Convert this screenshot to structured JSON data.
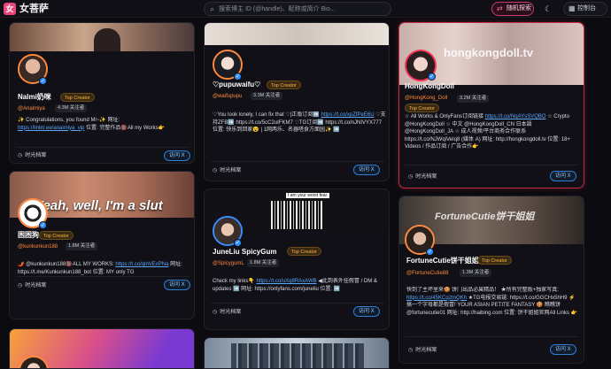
{
  "header": {
    "logo_glyph": "女",
    "app_name": "女菩萨",
    "search_placeholder": "搜索博主 ID (@handle)、昵称或简介 Bio...",
    "random_label": "随机探索",
    "console_label": "控制台"
  },
  "cards": [
    {
      "name": "Nalmi奶咪",
      "badge": "Top Creator",
      "handle": "@Analmiya",
      "followers": "4.3M 关注者",
      "bio_text": "✨ Congratulations, you found Mi~✨ 网址:",
      "bio_link": "https://linktr.ee/anaimiya_vip",
      "bio_tail": " 位置: 完整作品🔞All my Works👉",
      "archive": "时光档案",
      "visit": "访问 X"
    },
    {
      "name": "♡pupuwaifu♡",
      "badge": "Top Creator",
      "handle": "@waifupupu",
      "followers": "3.3M 关注者",
      "bio_text": "♡You look lonely, I can fix that ♡|正版订阅➡️",
      "bio_link": "https://t.co/xpZfPeE6U",
      "bio_tail": " ♡支持ZFB➡️ https://t.co/5cC2uIFKM7 ♡TG订阅➡️ https://t.co/nJNIVYX777 位置: 快乐到回家😵 | 1网两乐、名器嗒食方面园✨ ➡️",
      "archive": "时光档案",
      "visit": "访问 X"
    },
    {
      "name": "HongKongDoll",
      "badge": "Top Creator",
      "handle": "@HongKong_Doll",
      "followers": "3.2M 关注者",
      "banner_text": "hongkongdoll.tv",
      "bio_text": "☆ All Works & OnlyFans订阅链接 ",
      "bio_link": "https://t.co/NqAYsSVQBO",
      "bio_tail": " ☆ Crypto @HongKongDoll ☆ 中文 @HongKongDoll_CN 日本語 @HongKongDoll_JA ☆ 成人视频/平台商务合作联系 https://t.co/NJWqiVeIq8 (媒体 A) 网址: http://hongkongdoll.tv 位置: 18+ Videos / 作品订阅 / 广告合作👉",
      "archive": "时光档案",
      "visit": "访问 X"
    },
    {
      "name": "困困狗",
      "badge": "Top Creator",
      "handle": "@kunkunkun188",
      "followers": "1.8M 关注者",
      "banner_text": "Yeah, well, I'm a slut",
      "bio_text": "🌶️ @kunkunkun188🔞ALL MY WORKS: ",
      "bio_link": "https://t.co/qlnVExPNa",
      "bio_tail": " 网址: https://t.me/Kunkunkun188_bot 位置: MY only TG",
      "archive": "时光档案",
      "visit": "访问 X"
    },
    {
      "name": "JuneLiu SpicyGum",
      "badge": "Top Creator",
      "handle": "@SpicygumL",
      "followers": "1.8M 关注者",
      "banner_text": "I am your worst fear.",
      "bio_text": "Check my links👇 ",
      "bio_link": "https://t.co/uXq8RAxAWB",
      "bio_tail": " ◀此到表外挂假冒 / DM & updates ➡️ 网址: https://onlyfans.com/juneliu 位置: ➡️",
      "archive": "时光档案",
      "visit": "访问 X"
    },
    {
      "name": "FortuneCutie饼干姐姐",
      "badge": "Top Creator",
      "handle": "@FortuneCutie88",
      "followers": "1.3M 关注者",
      "banner_text": "FortuneCutie饼干姐姐",
      "bio_text": "快到了主坏里来🍪 饼门出品必属精品！ ★所有完整版+独家写真: ",
      "bio_link": "https://t.co/45KCq2mQKh",
      "bio_tail": " ★TG电报交易链: https://t.co/GGCHx5hH9 ⚡ 搞一个字母都是假冒! YOUR ASIAN PETITE FANTASY 🍪 瞧瞧饼 @fortunecutie01 网址: http://haibing.com 位置: 饼干姐姐官网All Links 👉",
      "archive": "时光档案",
      "visit": "访问 X"
    }
  ]
}
